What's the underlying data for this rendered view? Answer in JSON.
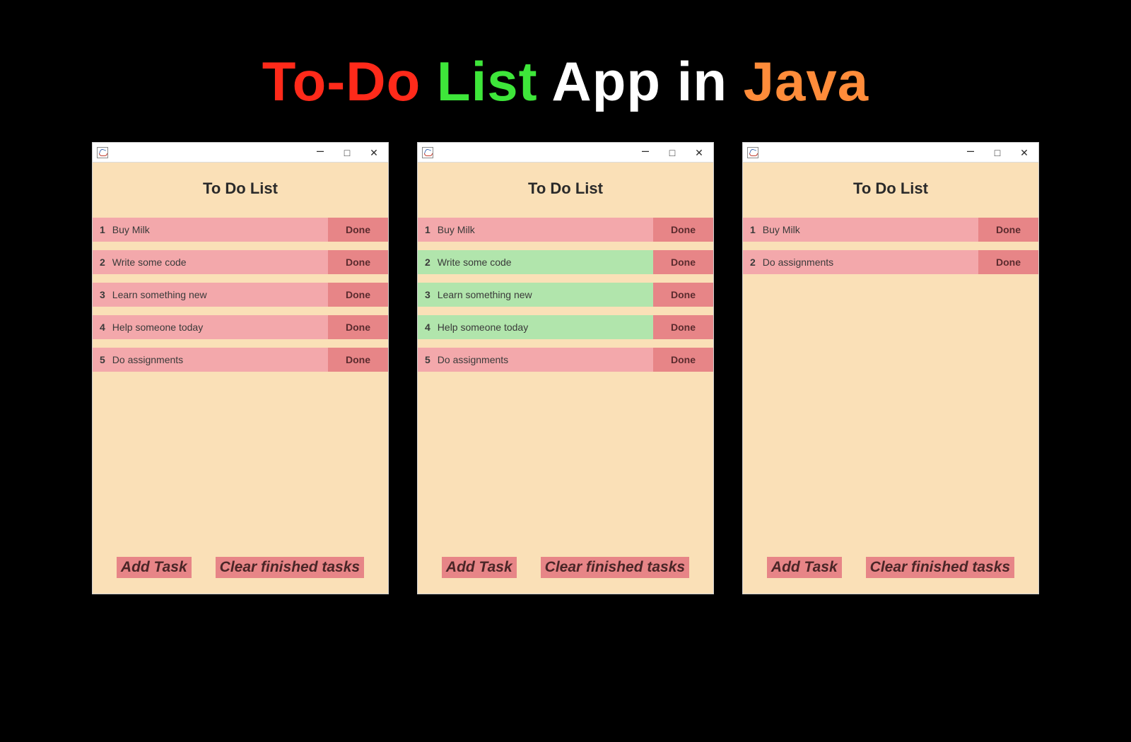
{
  "headline": {
    "p1": "To-Do",
    "p2": "List",
    "p3": "App in",
    "p4": "Java"
  },
  "app_title": "To Do List",
  "done_label": "Done",
  "footer": {
    "add": "Add Task",
    "clear": "Clear finished tasks"
  },
  "windows": [
    {
      "tasks": [
        {
          "num": "1",
          "text": "Buy Milk",
          "state": "pink"
        },
        {
          "num": "2",
          "text": "Write some code",
          "state": "pink"
        },
        {
          "num": "3",
          "text": "Learn something new",
          "state": "pink"
        },
        {
          "num": "4",
          "text": "Help someone today",
          "state": "pink"
        },
        {
          "num": "5",
          "text": "Do assignments",
          "state": "pink"
        }
      ]
    },
    {
      "tasks": [
        {
          "num": "1",
          "text": "Buy Milk",
          "state": "pink"
        },
        {
          "num": "2",
          "text": "Write some code",
          "state": "green"
        },
        {
          "num": "3",
          "text": "Learn something new",
          "state": "green"
        },
        {
          "num": "4",
          "text": "Help someone today",
          "state": "green"
        },
        {
          "num": "5",
          "text": "Do assignments",
          "state": "pink"
        }
      ]
    },
    {
      "tasks": [
        {
          "num": "1",
          "text": "Buy Milk",
          "state": "pink"
        },
        {
          "num": "2",
          "text": "Do assignments",
          "state": "pink"
        }
      ]
    }
  ]
}
